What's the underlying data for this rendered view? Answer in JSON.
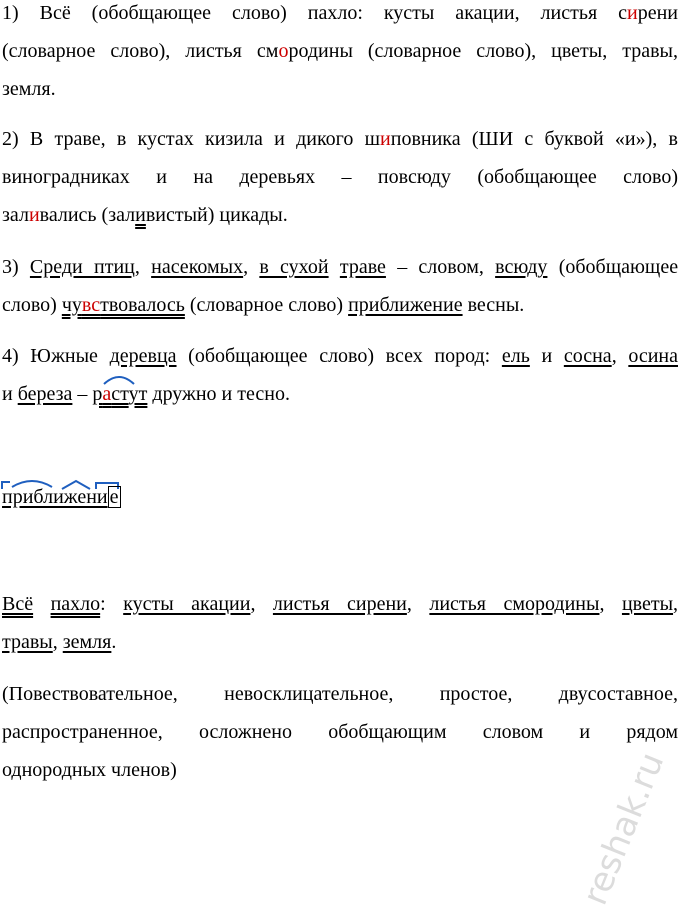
{
  "items": [
    {
      "line1": {
        "a": "1) Всё (обобщающее слово) пахло: кусты акации, листья с",
        "b": "и",
        "c": "рени"
      },
      "line2": {
        "a": "(словарное слово), листья см",
        "b": "о",
        "c": "родины (словарное слово), цветы, травы,"
      },
      "line3": "земля."
    },
    {
      "line1": {
        "a": "2) В траве, в кустах кизила и дикого ш",
        "b": "и",
        "c": "повника (ШИ с буквой «и»), в"
      },
      "line2": "виноградниках и на деревьях – повсюду (обобщающее слово)",
      "line3": {
        "a": "зал",
        "b": "и",
        "c": "вались (зал",
        "d": "и",
        "e": "вистый) цикады."
      }
    },
    {
      "line1": {
        "num": "3)",
        "w1": "Среди птиц",
        "w2": "насекомых",
        "w3": "в сухой",
        "w4": "траве",
        "t1": "– словом,",
        "w5": "всюду",
        "t2": "(обобщающее"
      },
      "line2": {
        "t1": "слово)",
        "w1a": "чу",
        "w1b": "вс",
        "w1c": "твовалось",
        "t2": "(словарное слово)",
        "w2": "приближение",
        "t3": "весны."
      }
    },
    {
      "line1": {
        "t1": "4) Южные",
        "w1": "деревца",
        "t2": "(обобщающее слово) всех пород:",
        "w2": "ель",
        "t3": "и",
        "w3": "сосна",
        "w4": "осина"
      },
      "line2": {
        "t1": "и",
        "w1": "береза",
        "t2": "–",
        "w2a": "р",
        "w2b": "а",
        "w2c": "ст",
        "w2d": "ут",
        "t3": "дружно и тесно."
      }
    }
  ],
  "morph": {
    "stem": "приближени",
    "ending": "е"
  },
  "analysis": {
    "line1": {
      "w1": "Всё",
      "w2": "пахло",
      "w3": "кусты акации",
      "w4": "листья сирени",
      "w5": "листья смородины",
      "w6": "цветы"
    },
    "line2": {
      "w1": "травы",
      "w2": "земля"
    },
    "desc1": "(Повествовательное, невосклицательное, простое, двусоставное,",
    "desc2": "распространенное, осложнено обобщающим словом и рядом",
    "desc3": "однородных членов)"
  },
  "watermark": "reshak.ru"
}
